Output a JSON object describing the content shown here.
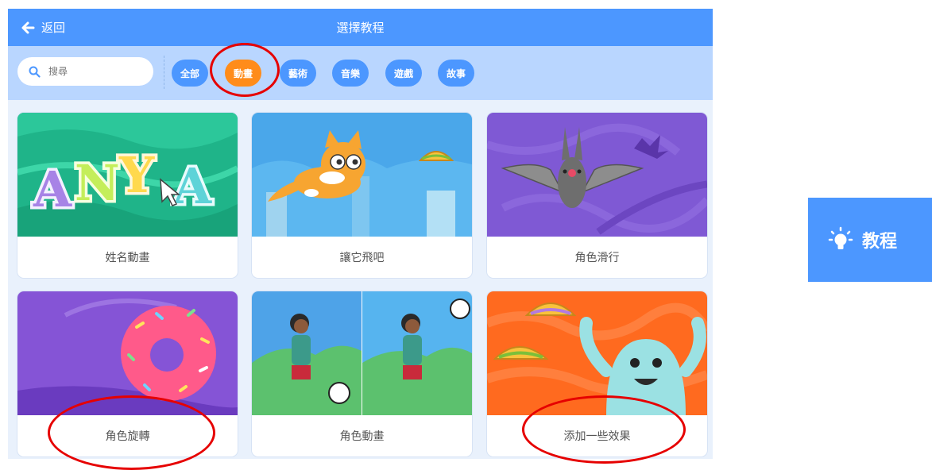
{
  "header": {
    "back_label": "返回",
    "title": "選擇教程"
  },
  "search": {
    "placeholder": "搜尋"
  },
  "filters": [
    {
      "label": "全部"
    },
    {
      "label": "動畫",
      "active": true
    },
    {
      "label": "藝術"
    },
    {
      "label": "音樂"
    },
    {
      "label": "遊戲"
    },
    {
      "label": "故事"
    }
  ],
  "cards": [
    {
      "label": "姓名動畫",
      "thumb_text": "ANYA"
    },
    {
      "label": "讓它飛吧"
    },
    {
      "label": "角色滑行"
    },
    {
      "label": "角色旋轉"
    },
    {
      "label": "角色動畫"
    },
    {
      "label": "添加一些效果"
    }
  ],
  "tutorial_button": {
    "label": "教程",
    "icon": "lightbulb-icon"
  },
  "colors": {
    "header": "#4c97ff",
    "filter_bar": "#b9d6ff",
    "active_pill": "#ff8c1a",
    "annotation": "#e60000"
  }
}
